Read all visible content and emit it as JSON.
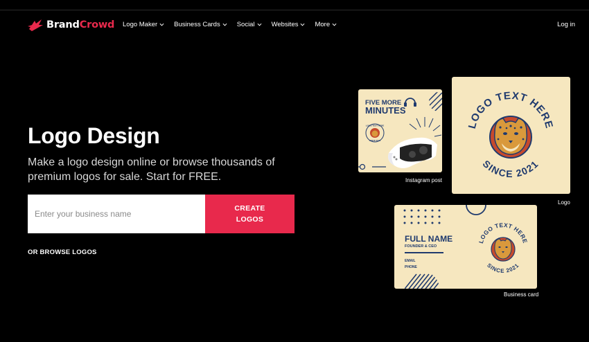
{
  "header": {
    "brand_part1": "Brand",
    "brand_part2": "Crowd",
    "nav": [
      "Logo Maker",
      "Business Cards",
      "Social",
      "Websites",
      "More"
    ],
    "login": "Log in"
  },
  "hero": {
    "title": "Logo Design",
    "subtitle": "Make a logo design online or browse thousands of premium logos for sale. Start for FREE.",
    "input_placeholder": "Enter your business name",
    "cta_line1": "CREATE",
    "cta_line2": "LOGOS",
    "browse": "OR BROWSE LOGOS"
  },
  "previews": {
    "instagram": {
      "caption": "Instagram post",
      "line1": "FIVE MORE",
      "line2": "MINUTES",
      "badge_top": "LOGO TEXT HERE",
      "badge_bottom": "SINCE 2021"
    },
    "logo": {
      "caption": "Logo",
      "arc_top": "LOGO TEXT HERE",
      "arc_bottom": "SINCE 2021"
    },
    "business_card": {
      "caption": "Business card",
      "name": "FULL NAME",
      "role": "FOUNDER & CEO",
      "email": "EMAIL",
      "phone": "PHONE",
      "arc_top": "LOGO TEXT HERE",
      "arc_bottom": "SINCE 2021"
    }
  },
  "colors": {
    "accent": "#e8294c",
    "background": "#000000",
    "card_bg": "#f6e7bf",
    "navy": "#1f3a6e"
  }
}
